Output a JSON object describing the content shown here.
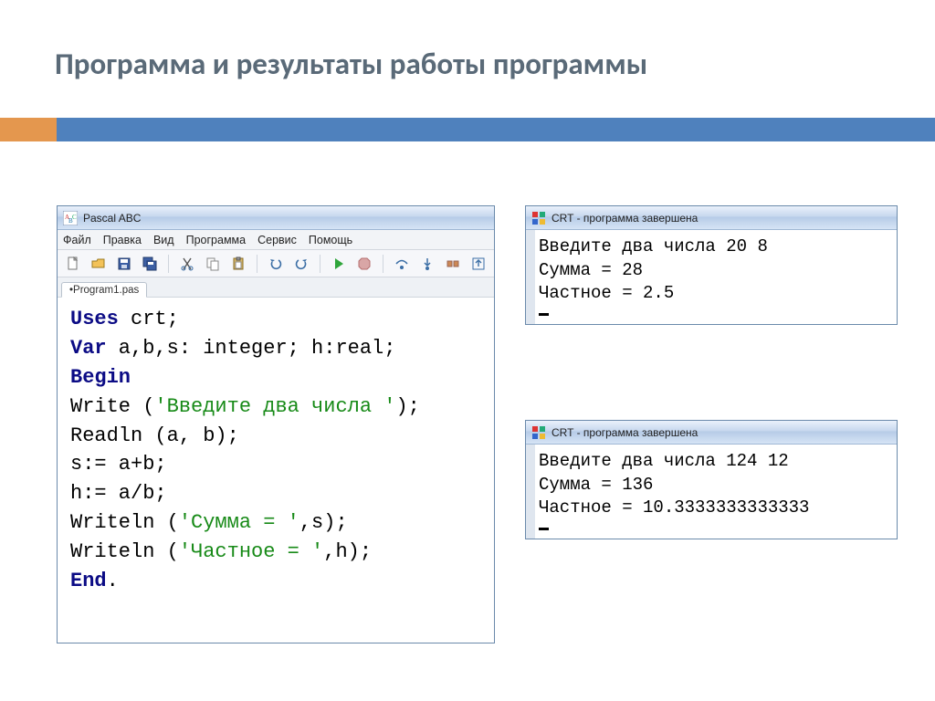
{
  "slide": {
    "title": "Программа и результаты работы программы"
  },
  "pascal": {
    "window_title": "Pascal ABC",
    "menu": [
      "Файл",
      "Правка",
      "Вид",
      "Программа",
      "Сервис",
      "Помощь"
    ],
    "tab": "•Program1.pas",
    "code": {
      "l1a": "Uses",
      "l1b": " crt;",
      "l2a": "Var",
      "l2b": " a,b,s: integer; h:real;",
      "l3": "Begin",
      "l4a": "Write (",
      "l4s": "'Введите два числа '",
      "l4b": ");",
      "l5": "Readln (a, b);",
      "l6": "s:= a+b;",
      "l7": "h:= a/b;",
      "l8a": "Writeln (",
      "l8s": "'Сумма = '",
      "l8b": ",s);",
      "l9a": "Writeln (",
      "l9s": "'Частное = '",
      "l9b": ",h);",
      "l10": "End"
    }
  },
  "crt1": {
    "title": "CRT - программа завершена",
    "out": "Введите два числа 20 8\nСумма = 28\nЧастное = 2.5"
  },
  "crt2": {
    "title": "CRT - программа завершена",
    "out": "Введите два числа 124 12\nСумма = 136\nЧастное = 10.3333333333333"
  },
  "icons": {
    "new": "new-file-icon",
    "open": "open-folder-icon",
    "save": "save-icon",
    "saveall": "save-all-icon",
    "cut": "cut-icon",
    "copy": "copy-icon",
    "paste": "paste-icon",
    "undo": "undo-icon",
    "redo": "redo-icon",
    "run": "run-icon",
    "stop": "stop-icon",
    "stepover": "step-over-icon",
    "stepinto": "step-into-icon",
    "breakpoint": "breakpoint-icon",
    "stepout": "step-out-icon"
  }
}
